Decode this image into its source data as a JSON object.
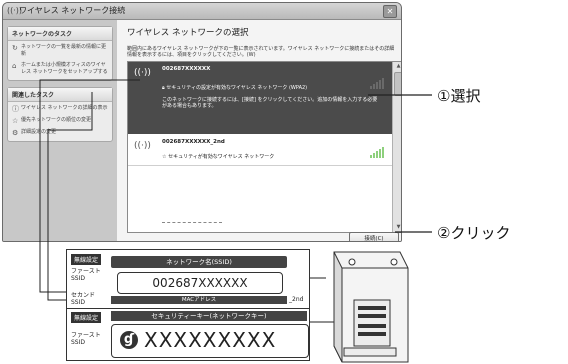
{
  "dialog": {
    "title": "ワイヤレス ネットワーク接続",
    "close_icon": "close-icon",
    "sidebar": {
      "panel1_title": "ネットワークのタスク",
      "tasks1": [
        {
          "icon": "refresh-icon",
          "label": "ネットワークの一覧を最新の情報に更新"
        },
        {
          "icon": "home-network-icon",
          "label": "ホームまたは小規模オフィスのワイヤレス ネットワークをセットアップする"
        }
      ],
      "panel2_title": "関連したタスク",
      "tasks2": [
        {
          "icon": "info-icon",
          "label": "ワイヤレス ネットワークの詳細の表示"
        },
        {
          "icon": "star-icon",
          "label": "優先ネットワークの順位の変更"
        },
        {
          "icon": "settings-icon",
          "label": "詳細設定の変更"
        }
      ]
    },
    "main": {
      "heading": "ワイヤレス ネットワークの選択",
      "description": "範囲内にあるワイヤレス ネットワークが下の一覧に表示されています。ワイヤレス ネットワークに接続またはその詳細情報を表示するには、項目をクリックしてください。(W)",
      "networks": [
        {
          "ssid": "002687XXXXXX",
          "security": "セキュリティの設定が有効なワイヤレス ネットワーク (WPA2)",
          "hint": "このネットワークに接続するには、[接続] をクリックしてください。追加の情報を入力する必要がある場合もあります。",
          "signal": 0.6
        },
        {
          "ssid": "002687XXXXXX_2nd",
          "security": "セキュリティが有効なワイヤレス ネットワーク",
          "signal": 0.8
        }
      ],
      "connect_label": "接続(C)"
    }
  },
  "callouts": {
    "select": "①選択",
    "click": "②クリック"
  },
  "label_card": {
    "section1_tag": "無線設定",
    "first_ssid_label": "ファースト\nSSID",
    "second_ssid_label": "セカンド\nSSID",
    "ssid_header": "ネットワーク名(SSID)",
    "ssid_value": "002687XXXXXX",
    "mac_header": "MACアドレス",
    "ssid2_suffix": "_2nd",
    "section2_tag": "無線設定",
    "key_header": "セキュリティーキー(ネットワークキー)",
    "key_label": "ファースト\nSSID",
    "key_value": "XXXXXXXXX"
  },
  "colors": {
    "selected_row": "#4b4b4b",
    "signal_green": "#8ed07d",
    "label_dark": "#444444"
  }
}
